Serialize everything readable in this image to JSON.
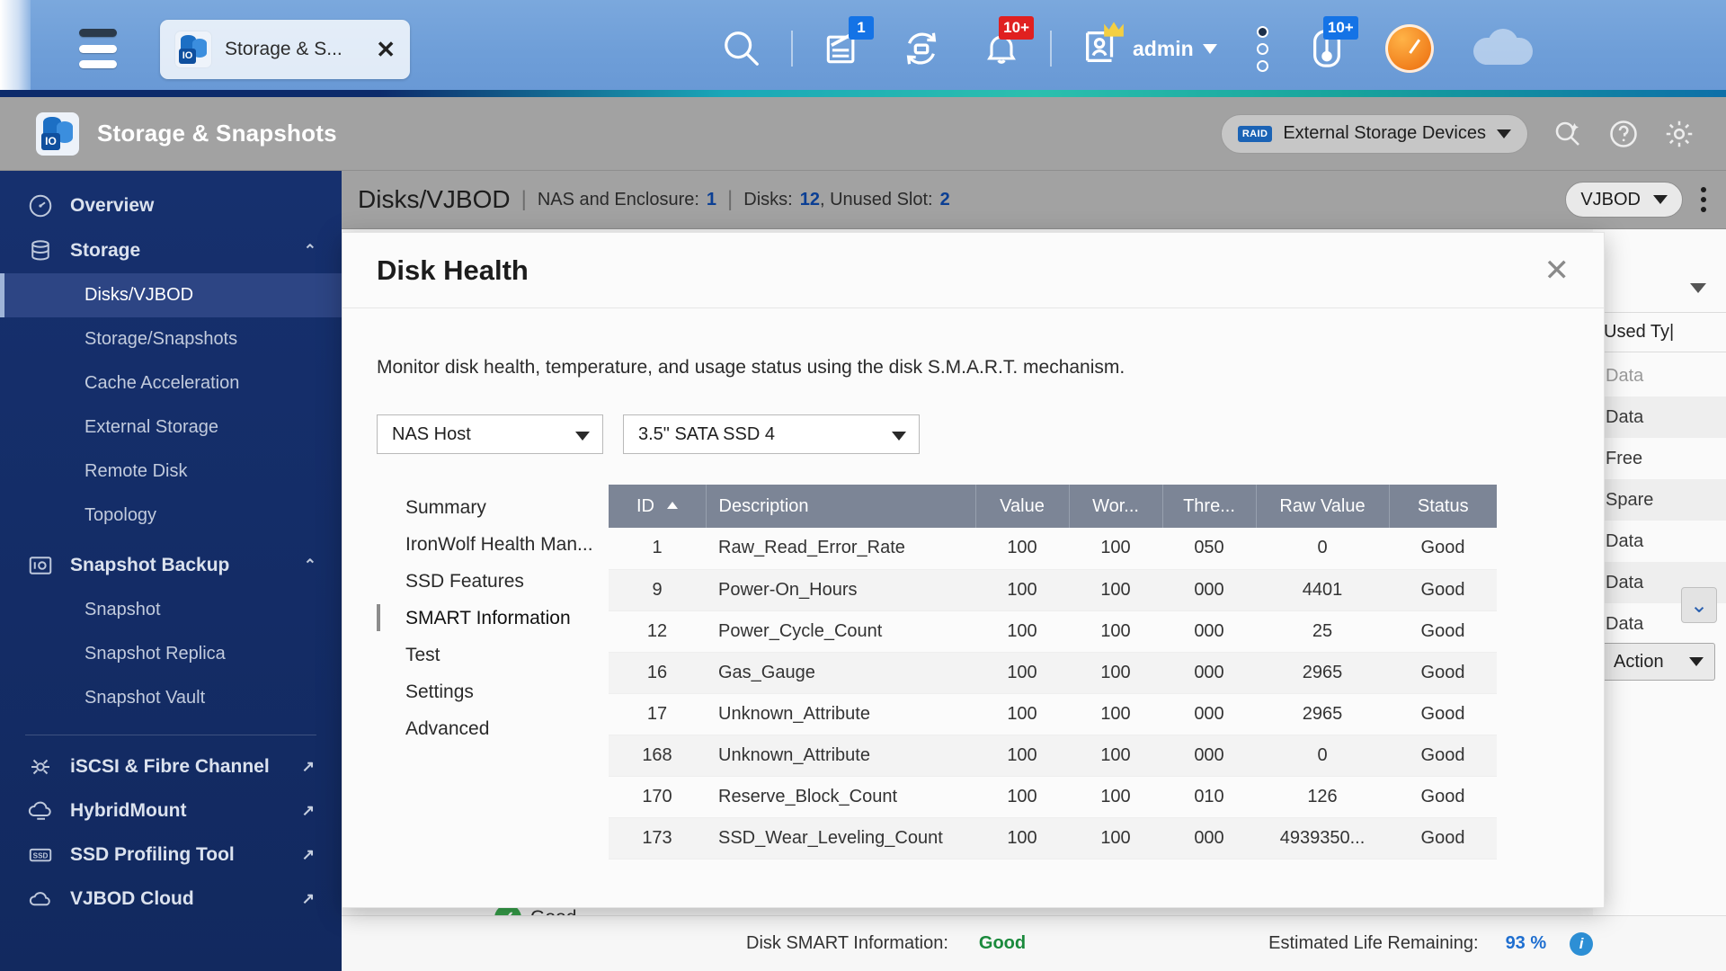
{
  "taskbar": {
    "menu_icon": "hamburger-icon",
    "tab": {
      "title": "Storage & S...",
      "close": "✕",
      "app_icon": "storage-snapshots-icon",
      "io_label": "IO"
    },
    "icons": [
      {
        "name": "search-icon",
        "badge": ""
      },
      {
        "name": "background-tasks-icon",
        "badge": "1",
        "badge_color": "blue"
      },
      {
        "name": "external-device-sync-icon",
        "badge": ""
      },
      {
        "name": "notifications-bell-icon",
        "badge": "10+",
        "badge_color": "red"
      }
    ],
    "user": {
      "label": "admin",
      "crown": "admin-crown-icon"
    },
    "dots_icon": "more-options-icon",
    "monitor_badge": "10+",
    "resource_monitor_icon": "resource-monitor-icon",
    "dashboard_icon": "dashboard-speedometer-icon",
    "cloud_icon": "qnap-cloud-icon"
  },
  "app_header": {
    "title": "Storage & Snapshots",
    "external_storage_button": {
      "label": "External Storage Devices",
      "chip": "RAID"
    },
    "icons": [
      "global-settings-icon",
      "help-icon",
      "settings-gear-icon"
    ]
  },
  "sidebar": {
    "groups": [
      {
        "label": "Overview",
        "icon": "overview-gauge-icon",
        "chevron": "",
        "items": []
      },
      {
        "label": "Storage",
        "icon": "storage-database-icon",
        "chevron": "⌃",
        "items": [
          {
            "label": "Disks/VJBOD",
            "active": true
          },
          {
            "label": "Storage/Snapshots",
            "active": false
          },
          {
            "label": "Cache Acceleration",
            "active": false
          },
          {
            "label": "External Storage",
            "active": false
          },
          {
            "label": "Remote Disk",
            "active": false
          },
          {
            "label": "Topology",
            "active": false
          }
        ]
      },
      {
        "label": "Snapshot Backup",
        "icon": "snapshot-backup-icon",
        "chevron": "⌃",
        "items": [
          {
            "label": "Snapshot",
            "active": false
          },
          {
            "label": "Snapshot Replica",
            "active": false
          },
          {
            "label": "Snapshot Vault",
            "active": false
          }
        ]
      }
    ],
    "external_links": [
      {
        "label": "iSCSI & Fibre Channel",
        "icon": "iscsi-fibre-icon"
      },
      {
        "label": "HybridMount",
        "icon": "hybridmount-icon"
      },
      {
        "label": "SSD Profiling Tool",
        "icon": "ssd-profiling-icon"
      },
      {
        "label": "VJBOD Cloud",
        "icon": "vjbod-cloud-icon"
      }
    ],
    "external_link_glyph": "↗"
  },
  "content_bar": {
    "title": "Disks/VJBOD",
    "nas_label": "NAS and Enclosure:",
    "nas_value": "1",
    "disks_label": "Disks:",
    "disks_value": "12",
    "unused_label": ", Unused Slot:",
    "unused_value": "2",
    "vjbod_selector": "VJBOD",
    "kebab_icon": "more-actions-icon"
  },
  "right_panel": {
    "column_header": "Used Ty|",
    "rows": [
      "Data",
      "Data",
      "Free",
      "Spare",
      "Data",
      "Data",
      "Data"
    ],
    "expand_icon": "expand-down-icon",
    "action_label": "Action"
  },
  "status_strip": {
    "disk_health_badge": "Good",
    "smart_label": "Disk SMART Information:",
    "smart_value": "Good",
    "life_label": "Estimated Life Remaining:",
    "life_value": "93 %",
    "info_icon": "info-icon"
  },
  "modal": {
    "title": "Disk Health",
    "close_icon": "close-icon",
    "description": "Monitor disk health, temperature, and usage status using the disk S.M.A.R.T. mechanism.",
    "selects": [
      {
        "name": "host-select",
        "value": "NAS Host"
      },
      {
        "name": "disk-select",
        "value": "3.5\" SATA SSD 4"
      }
    ],
    "nav": [
      {
        "label": "Summary",
        "active": false
      },
      {
        "label": "IronWolf Health Man...",
        "active": false
      },
      {
        "label": "SSD Features",
        "active": false
      },
      {
        "label": "SMART Information",
        "active": true
      },
      {
        "label": "Test",
        "active": false
      },
      {
        "label": "Settings",
        "active": false
      },
      {
        "label": "Advanced",
        "active": false
      }
    ],
    "table": {
      "columns": [
        "ID",
        "Description",
        "Value",
        "Wor...",
        "Thre...",
        "Raw Value",
        "Status"
      ],
      "sorted_column": "ID",
      "sort_direction": "asc",
      "rows": [
        {
          "id": "1",
          "description": "Raw_Read_Error_Rate",
          "value": "100",
          "worst": "100",
          "threshold": "050",
          "raw": "0",
          "status": "Good"
        },
        {
          "id": "9",
          "description": "Power-On_Hours",
          "value": "100",
          "worst": "100",
          "threshold": "000",
          "raw": "4401",
          "status": "Good"
        },
        {
          "id": "12",
          "description": "Power_Cycle_Count",
          "value": "100",
          "worst": "100",
          "threshold": "000",
          "raw": "25",
          "status": "Good"
        },
        {
          "id": "16",
          "description": "Gas_Gauge",
          "value": "100",
          "worst": "100",
          "threshold": "000",
          "raw": "2965",
          "status": "Good"
        },
        {
          "id": "17",
          "description": "Unknown_Attribute",
          "value": "100",
          "worst": "100",
          "threshold": "000",
          "raw": "2965",
          "status": "Good"
        },
        {
          "id": "168",
          "description": "Unknown_Attribute",
          "value": "100",
          "worst": "100",
          "threshold": "000",
          "raw": "0",
          "status": "Good"
        },
        {
          "id": "170",
          "description": "Reserve_Block_Count",
          "value": "100",
          "worst": "100",
          "threshold": "010",
          "raw": "126",
          "status": "Good"
        },
        {
          "id": "173",
          "description": "SSD_Wear_Leveling_Count",
          "value": "100",
          "worst": "100",
          "threshold": "000",
          "raw": "4939350...",
          "status": "Good"
        }
      ]
    }
  }
}
